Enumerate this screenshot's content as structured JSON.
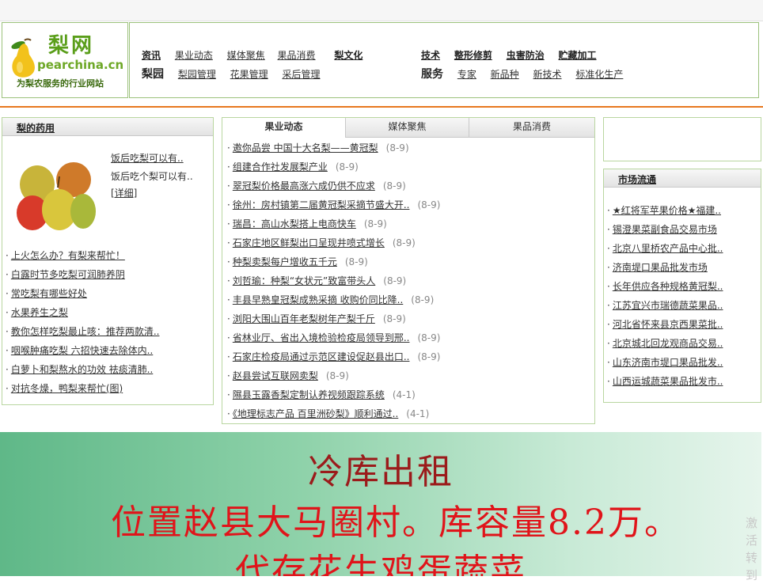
{
  "logo": {
    "title": "梨网",
    "url": "pearchina.cn",
    "slogan": "为梨农服务的行业网站"
  },
  "nav": {
    "news": {
      "label": "资讯",
      "items": [
        "果业动态",
        "媒体聚焦",
        "果品消费"
      ],
      "extra": "梨文化"
    },
    "orchard": {
      "label": "梨园",
      "items": [
        "梨园管理",
        "花果管理",
        "采后管理"
      ]
    },
    "tech": {
      "label": "技术",
      "items": [
        "整形修剪",
        "虫害防治",
        "贮藏加工"
      ]
    },
    "service": {
      "label": "服务",
      "items": [
        "专家",
        "新品种",
        "新技术",
        "标准化生产"
      ]
    }
  },
  "left_panel": {
    "title": "梨的药用",
    "feature": {
      "title": "饭后吃梨可以有..",
      "desc": "饭后吃个梨可以有..",
      "more": "[详细]"
    },
    "items": [
      "上火怎么办？有梨来帮忙！",
      "白露时节多吃梨可润肺养阴",
      "常吃梨有哪些好处",
      "水果养生之梨",
      "教你怎样吃梨最止咳：推荐两款清..",
      "咽喉肿痛吃梨 六招快速去除体内..",
      "白萝卜和梨熬水的功效 祛痰清肺..",
      "对抗冬燥，鸭梨来帮忙(图)"
    ]
  },
  "center_panel": {
    "tabs": [
      "果业动态",
      "媒体聚焦",
      "果品消费"
    ],
    "items": [
      {
        "title": "邀你品尝 中国十大名梨——黄冠梨",
        "date": "(8-9)"
      },
      {
        "title": "组建合作社发展梨产业",
        "date": "(8-9)"
      },
      {
        "title": "翠冠梨价格最高涨六成仍供不应求",
        "date": "(8-9)"
      },
      {
        "title": "徐州：房村镇第二届黄冠梨采摘节盛大开..",
        "date": "(8-9)"
      },
      {
        "title": "瑞昌：高山水梨搭上电商快车",
        "date": "(8-9)"
      },
      {
        "title": "石家庄地区鲜梨出口呈现井喷式增长",
        "date": "(8-9)"
      },
      {
        "title": "种梨卖梨每户增收五千元",
        "date": "(8-9)"
      },
      {
        "title": "刘哲瑜：种梨“女状元”致富带头人",
        "date": "(8-9)"
      },
      {
        "title": "丰县早熟皇冠梨成熟采摘 收购价同比降..",
        "date": "(8-9)"
      },
      {
        "title": "浏阳大围山百年老梨树年产梨千斤",
        "date": "(8-9)"
      },
      {
        "title": "省林业厅、省出入境检验检疫局领导到邢..",
        "date": "(8-9)"
      },
      {
        "title": "石家庄检疫局通过示范区建设促赵县出口..",
        "date": "(8-9)"
      },
      {
        "title": "赵县尝试互联网卖梨",
        "date": "(8-9)"
      },
      {
        "title": "隰县玉露香梨定制认养视频跟踪系统",
        "date": "(4-1)"
      },
      {
        "title": "《地理标志产品 百里洲砂梨》顺利通过..",
        "date": "(4-1)"
      }
    ]
  },
  "right_panel": {
    "title": "市场流通",
    "items": [
      "★红将军苹果价格★福建..",
      "锡澄果菜副食品交易市场",
      "北京八里桥农产品中心批..",
      "济南堤口果品批发市场",
      "长年供应各种规格黄冠梨..",
      "江苏宜兴市瑞德蔬菜果品..",
      "河北省怀来县京西果菜批..",
      "北京城北回龙观商品交易..",
      "山东济南市堤口果品批发..",
      "山西运城蔬菜果品批发市.."
    ]
  },
  "banner": {
    "line1": "冷库出租",
    "line2": "位置赵县大马圈村。库容量8.2万。",
    "line3": "代存花生鸡蛋蔬菜"
  },
  "watermark": {
    "text": "激活 转到"
  },
  "colors": {
    "accent_orange": "#e8781e",
    "border_green": "#b9d6a0",
    "logo_green": "#5a9e1a",
    "banner_red": "#e0141a"
  }
}
